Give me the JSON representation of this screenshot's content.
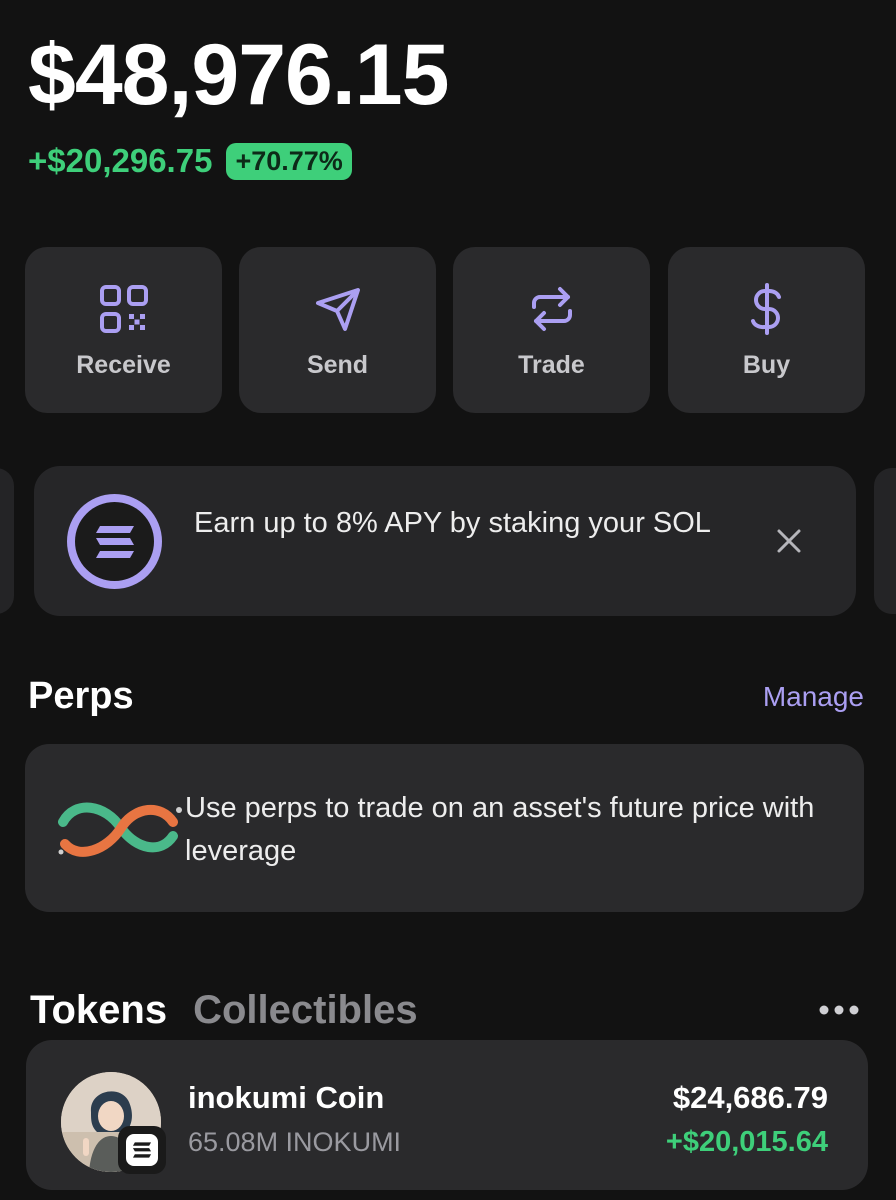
{
  "portfolio": {
    "balance": "$48,976.15",
    "change_amount": "+$20,296.75",
    "change_percent": "+70.77%"
  },
  "actions": [
    {
      "label": "Receive",
      "icon": "qr-code-icon"
    },
    {
      "label": "Send",
      "icon": "send-icon"
    },
    {
      "label": "Trade",
      "icon": "swap-icon"
    },
    {
      "label": "Buy",
      "icon": "dollar-icon"
    }
  ],
  "banner": {
    "text": "Earn up to 8% APY by staking your SOL",
    "icon": "solana-icon",
    "close_icon": "close-icon"
  },
  "perps": {
    "title": "Perps",
    "manage_label": "Manage",
    "card_text": "Use perps to trade on an asset's future price with leverage",
    "icon": "perps-infinity-icon"
  },
  "tabs": {
    "tokens": "Tokens",
    "collectibles": "Collectibles",
    "more_icon": "more-icon"
  },
  "tokens": [
    {
      "name": "inokumi Coin",
      "amount": "65.08M INOKUMI",
      "value": "$24,686.79",
      "change": "+$20,015.64",
      "chain_icon": "solana-icon"
    }
  ],
  "colors": {
    "accent": "#ab9ff2",
    "positive": "#3ecf7a",
    "background": "#121212",
    "card": "#2a2a2c"
  }
}
